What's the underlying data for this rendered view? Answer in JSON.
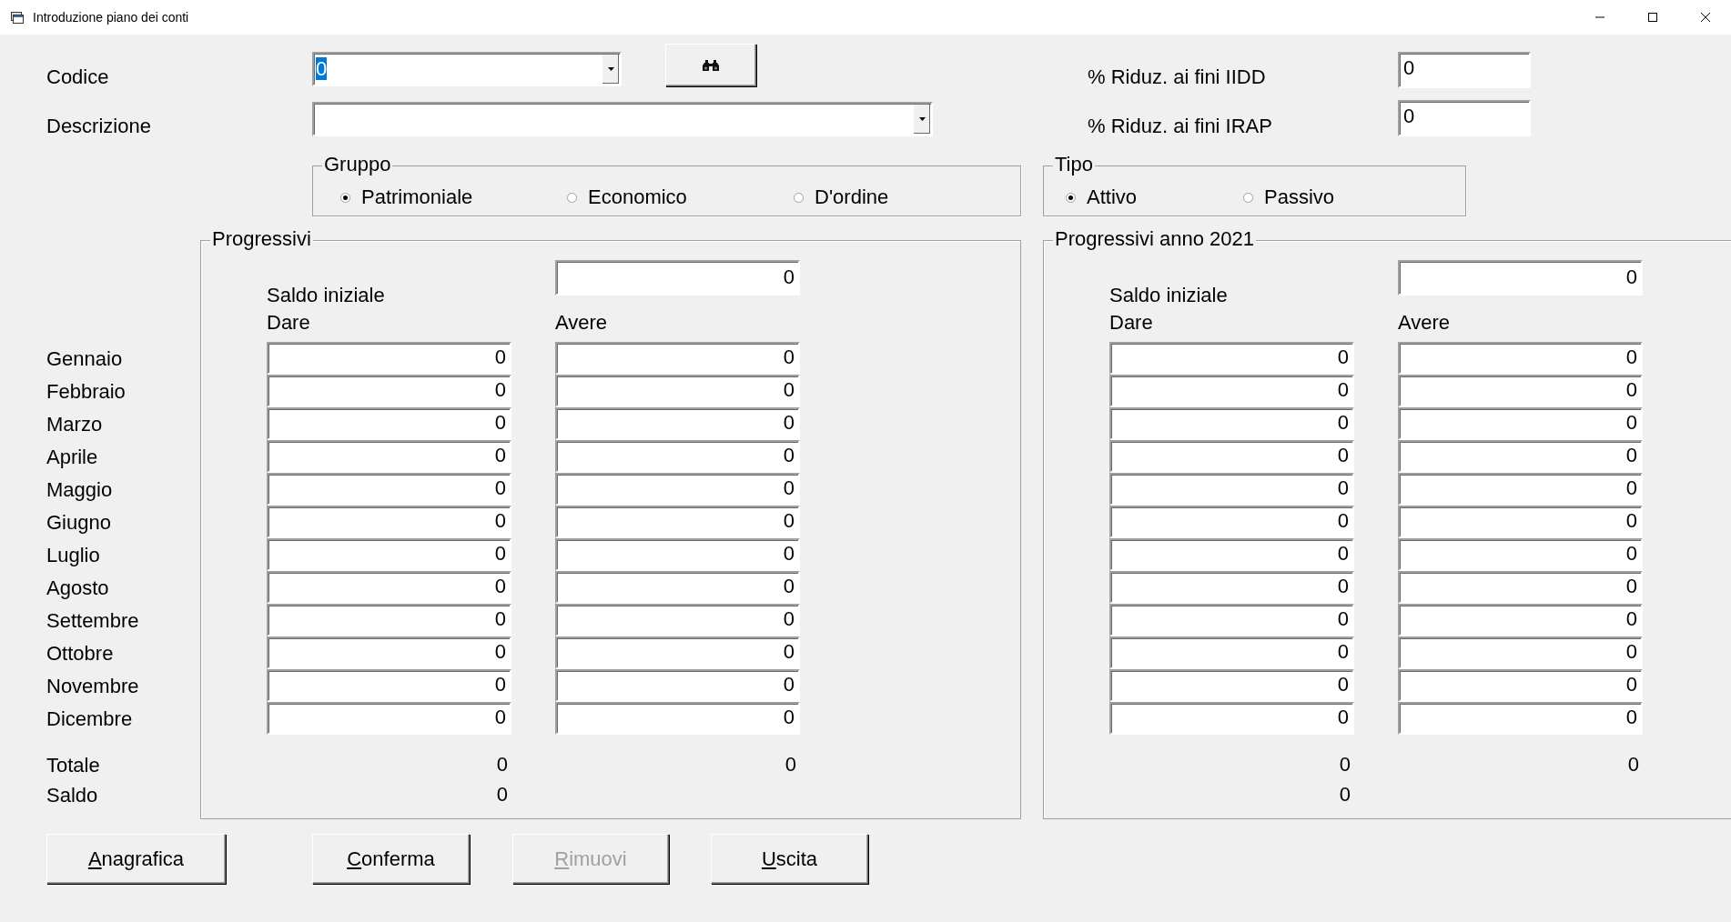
{
  "window": {
    "title": "Introduzione piano dei conti"
  },
  "codice": {
    "label": "Codice",
    "value": "0",
    "value_selected": true
  },
  "descrizione": {
    "label": "Descrizione"
  },
  "riduzioni": [
    {
      "label": "% Riduz. ai fini IIDD",
      "value": "0"
    },
    {
      "label": "% Riduz. ai fini IRAP",
      "value": "0"
    }
  ],
  "gruppo": {
    "title": "Gruppo",
    "options": [
      {
        "label": "Patrimoniale",
        "selected": true
      },
      {
        "label": "Economico",
        "selected": false
      },
      {
        "label": "D'ordine",
        "selected": false
      }
    ]
  },
  "tipo": {
    "title": "Tipo",
    "options": [
      {
        "label": "Attivo",
        "selected": true
      },
      {
        "label": "Passivo",
        "selected": false
      }
    ]
  },
  "months": [
    "Gennaio",
    "Febbraio",
    "Marzo",
    "Aprile",
    "Maggio",
    "Giugno",
    "Luglio",
    "Agosto",
    "Settembre",
    "Ottobre",
    "Novembre",
    "Dicembre"
  ],
  "totale_label": "Totale",
  "saldo_label": "Saldo",
  "progressivi": [
    {
      "title": "Progressivi",
      "saldo_iniziale_label": "Saldo iniziale",
      "saldo_iniziale": "0",
      "dare_label": "Dare",
      "avere_label": "Avere",
      "rows": [
        {
          "dare": "0",
          "avere": "0"
        },
        {
          "dare": "0",
          "avere": "0"
        },
        {
          "dare": "0",
          "avere": "0"
        },
        {
          "dare": "0",
          "avere": "0"
        },
        {
          "dare": "0",
          "avere": "0"
        },
        {
          "dare": "0",
          "avere": "0"
        },
        {
          "dare": "0",
          "avere": "0"
        },
        {
          "dare": "0",
          "avere": "0"
        },
        {
          "dare": "0",
          "avere": "0"
        },
        {
          "dare": "0",
          "avere": "0"
        },
        {
          "dare": "0",
          "avere": "0"
        },
        {
          "dare": "0",
          "avere": "0"
        }
      ],
      "totale_dare": "0",
      "totale_avere": "0",
      "saldo": "0"
    },
    {
      "title": "Progressivi anno 2021",
      "saldo_iniziale_label": "Saldo iniziale",
      "saldo_iniziale": "0",
      "dare_label": "Dare",
      "avere_label": "Avere",
      "rows": [
        {
          "dare": "0",
          "avere": "0"
        },
        {
          "dare": "0",
          "avere": "0"
        },
        {
          "dare": "0",
          "avere": "0"
        },
        {
          "dare": "0",
          "avere": "0"
        },
        {
          "dare": "0",
          "avere": "0"
        },
        {
          "dare": "0",
          "avere": "0"
        },
        {
          "dare": "0",
          "avere": "0"
        },
        {
          "dare": "0",
          "avere": "0"
        },
        {
          "dare": "0",
          "avere": "0"
        },
        {
          "dare": "0",
          "avere": "0"
        },
        {
          "dare": "0",
          "avere": "0"
        },
        {
          "dare": "0",
          "avere": "0"
        }
      ],
      "totale_dare": "0",
      "totale_avere": "0",
      "saldo": "0"
    }
  ],
  "buttons": [
    {
      "label": "Anagrafica",
      "disabled": false
    },
    {
      "label": "Conferma",
      "disabled": false
    },
    {
      "label": "Rimuovi",
      "disabled": true
    },
    {
      "label": "Uscita",
      "disabled": false
    }
  ]
}
